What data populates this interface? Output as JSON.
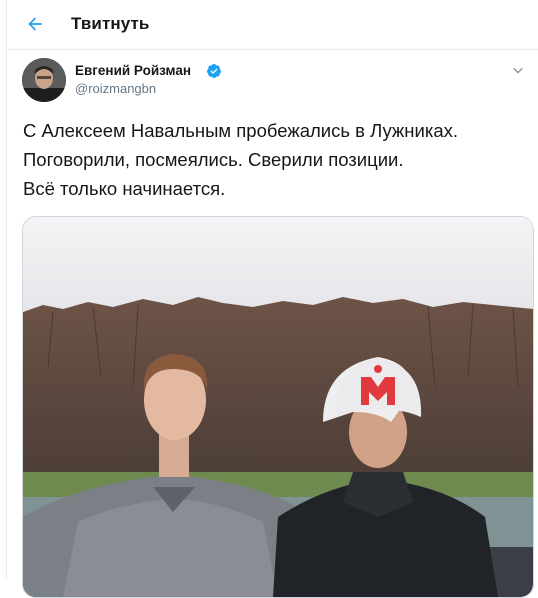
{
  "header": {
    "title": "Твитнуть",
    "back_icon": "arrow-left-icon"
  },
  "author": {
    "display_name": "Евгений Ройзман",
    "handle": "@roizmangbn",
    "verified": true
  },
  "tweet": {
    "lines": [
      "С Алексеем Навальным пробежались в Лужниках.",
      "Поговорили, посмеялись. Сверили позиции.",
      "Всё только начинается."
    ]
  },
  "colors": {
    "accent": "#1da1f2",
    "text": "#14171a",
    "secondary": "#657786",
    "border": "#e6ecf0"
  }
}
